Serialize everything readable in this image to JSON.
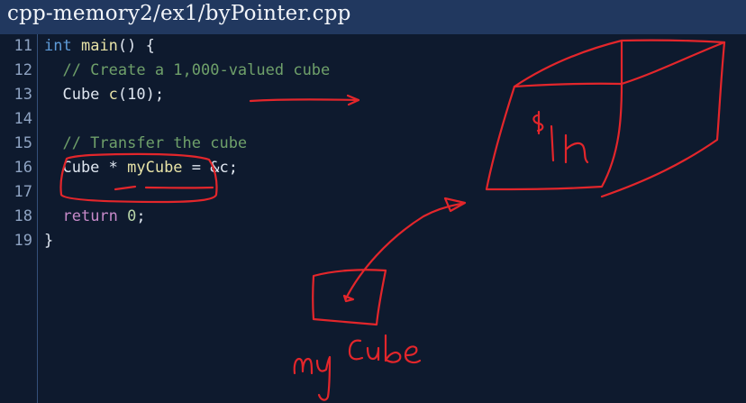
{
  "header": {
    "file_path": "cpp-memory2/ex1/byPointer.cpp"
  },
  "code": {
    "line_numbers": [
      "11",
      "12",
      "13",
      "14",
      "15",
      "16",
      "17",
      "18",
      "19"
    ],
    "lines": [
      {
        "t1": "int",
        "t2": " ",
        "t3": "main",
        "t4": "() {"
      },
      {
        "comment": "  // Create a 1,000-valued cube"
      },
      {
        "t1": "  Cube ",
        "t2": "c",
        "t3": "(10);"
      },
      {},
      {
        "comment": "  // Transfer the cube"
      },
      {
        "t1": "  Cube * ",
        "t2": "myCube",
        "t3": " = &c;"
      },
      {},
      {
        "t1": "  ",
        "t2": "return",
        "t3": " ",
        "t4": "0",
        "t5": ";"
      },
      {
        "t1": "}"
      }
    ]
  },
  "annotations": {
    "box_label": "$1k",
    "label_my": "my",
    "label_cube": "Cube",
    "ink_color": "#e3262b"
  }
}
